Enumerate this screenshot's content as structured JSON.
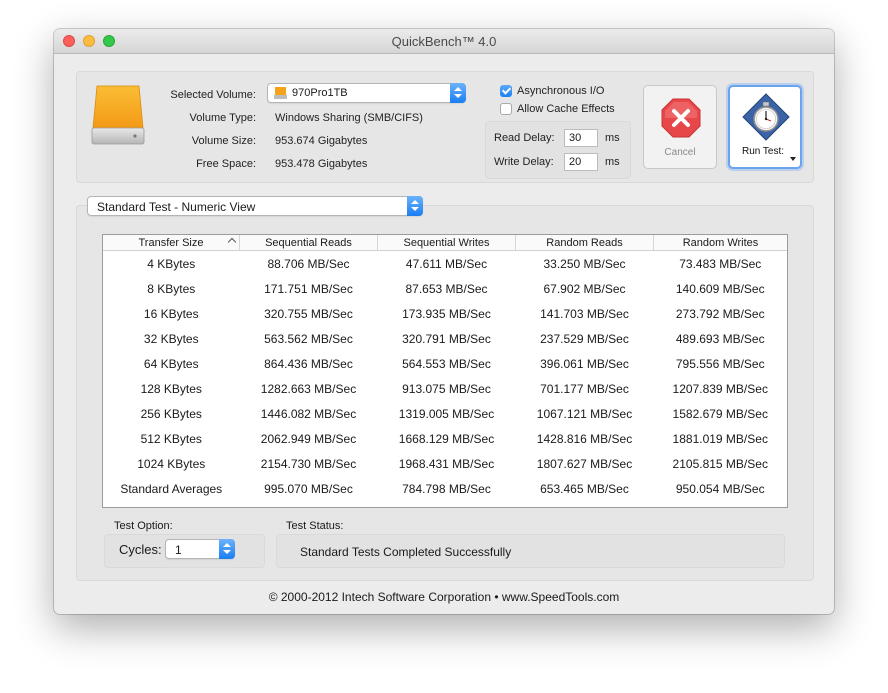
{
  "window": {
    "title": "QuickBench™ 4.0"
  },
  "volume": {
    "selected_label": "Selected Volume:",
    "selected_value": "970Pro1TB",
    "type_label": "Volume Type:",
    "type_value": "Windows Sharing (SMB/CIFS)",
    "size_label": "Volume Size:",
    "size_value": "953.674 Gigabytes",
    "free_label": "Free Space:",
    "free_value": "953.478 Gigabytes"
  },
  "options": {
    "async_label": "Asynchronous I/O",
    "async_checked": true,
    "cache_label": "Allow Cache Effects",
    "cache_checked": false,
    "read_delay_label": "Read Delay:",
    "read_delay_value": "30",
    "read_delay_unit": "ms",
    "write_delay_label": "Write Delay:",
    "write_delay_value": "20",
    "write_delay_unit": "ms"
  },
  "buttons": {
    "cancel_label": "Cancel",
    "run_label": "Run Test:"
  },
  "view_select": {
    "value": "Standard Test - Numeric View"
  },
  "table": {
    "columns": [
      "Transfer Size",
      "Sequential Reads",
      "Sequential Writes",
      "Random Reads",
      "Random Writes"
    ],
    "rows": [
      [
        "4 KBytes",
        "88.706 MB/Sec",
        "47.611 MB/Sec",
        "33.250 MB/Sec",
        "73.483 MB/Sec"
      ],
      [
        "8 KBytes",
        "171.751 MB/Sec",
        "87.653 MB/Sec",
        "67.902 MB/Sec",
        "140.609 MB/Sec"
      ],
      [
        "16 KBytes",
        "320.755 MB/Sec",
        "173.935 MB/Sec",
        "141.703 MB/Sec",
        "273.792 MB/Sec"
      ],
      [
        "32 KBytes",
        "563.562 MB/Sec",
        "320.791 MB/Sec",
        "237.529 MB/Sec",
        "489.693 MB/Sec"
      ],
      [
        "64 KBytes",
        "864.436 MB/Sec",
        "564.553 MB/Sec",
        "396.061 MB/Sec",
        "795.556 MB/Sec"
      ],
      [
        "128 KBytes",
        "1282.663 MB/Sec",
        "913.075 MB/Sec",
        "701.177 MB/Sec",
        "1207.839 MB/Sec"
      ],
      [
        "256 KBytes",
        "1446.082 MB/Sec",
        "1319.005 MB/Sec",
        "1067.121 MB/Sec",
        "1582.679 MB/Sec"
      ],
      [
        "512 KBytes",
        "2062.949 MB/Sec",
        "1668.129 MB/Sec",
        "1428.816 MB/Sec",
        "1881.019 MB/Sec"
      ],
      [
        "1024 KBytes",
        "2154.730 MB/Sec",
        "1968.431 MB/Sec",
        "1807.627 MB/Sec",
        "2105.815 MB/Sec"
      ],
      [
        "Standard Averages",
        "995.070 MB/Sec",
        "784.798 MB/Sec",
        "653.465 MB/Sec",
        "950.054 MB/Sec"
      ]
    ]
  },
  "test_option": {
    "label": "Test Option:",
    "cycles_label": "Cycles:",
    "cycles_value": "1"
  },
  "test_status": {
    "label": "Test Status:",
    "message": "Standard Tests Completed Successfully"
  },
  "footer": {
    "copyright": "© 2000-2012 Intech Software Corporation • www.SpeedTools.com"
  },
  "colors": {
    "accent": "#1d7ff2",
    "drive_orange": "#f7a21b",
    "cancel_red": "#e8474a"
  }
}
